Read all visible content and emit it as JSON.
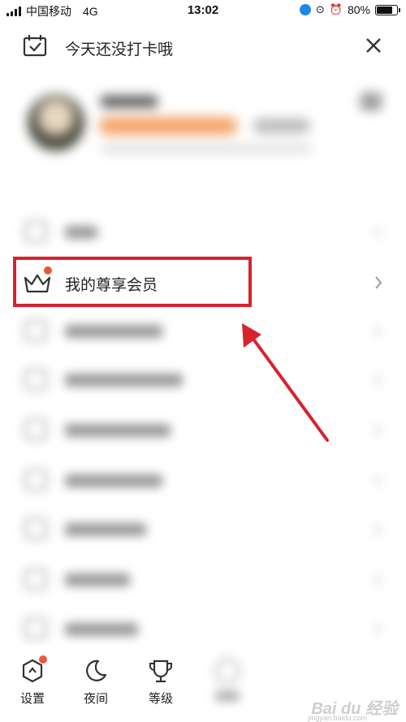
{
  "status_bar": {
    "carrier": "中国移动",
    "network": "4G",
    "time": "13:02",
    "battery": "80%",
    "battery_level": 0.8
  },
  "header": {
    "title": "今天还没打卡哦",
    "calendar_icon": "calendar-check-icon",
    "close_icon": "close-icon"
  },
  "menu": {
    "vip_label": "我的尊享会员",
    "vip_icon": "crown-icon"
  },
  "bottom_bar": {
    "items": [
      {
        "label": "设置",
        "icon": "settings-hexagon-icon"
      },
      {
        "label": "夜间",
        "icon": "moon-icon"
      },
      {
        "label": "等级",
        "icon": "trophy-icon"
      }
    ]
  },
  "watermark": {
    "text": "Bai du 经验",
    "sub": "jingyan.baidu.com"
  },
  "colors": {
    "highlight": "#d8222f",
    "notification_dot": "#e8573f"
  }
}
